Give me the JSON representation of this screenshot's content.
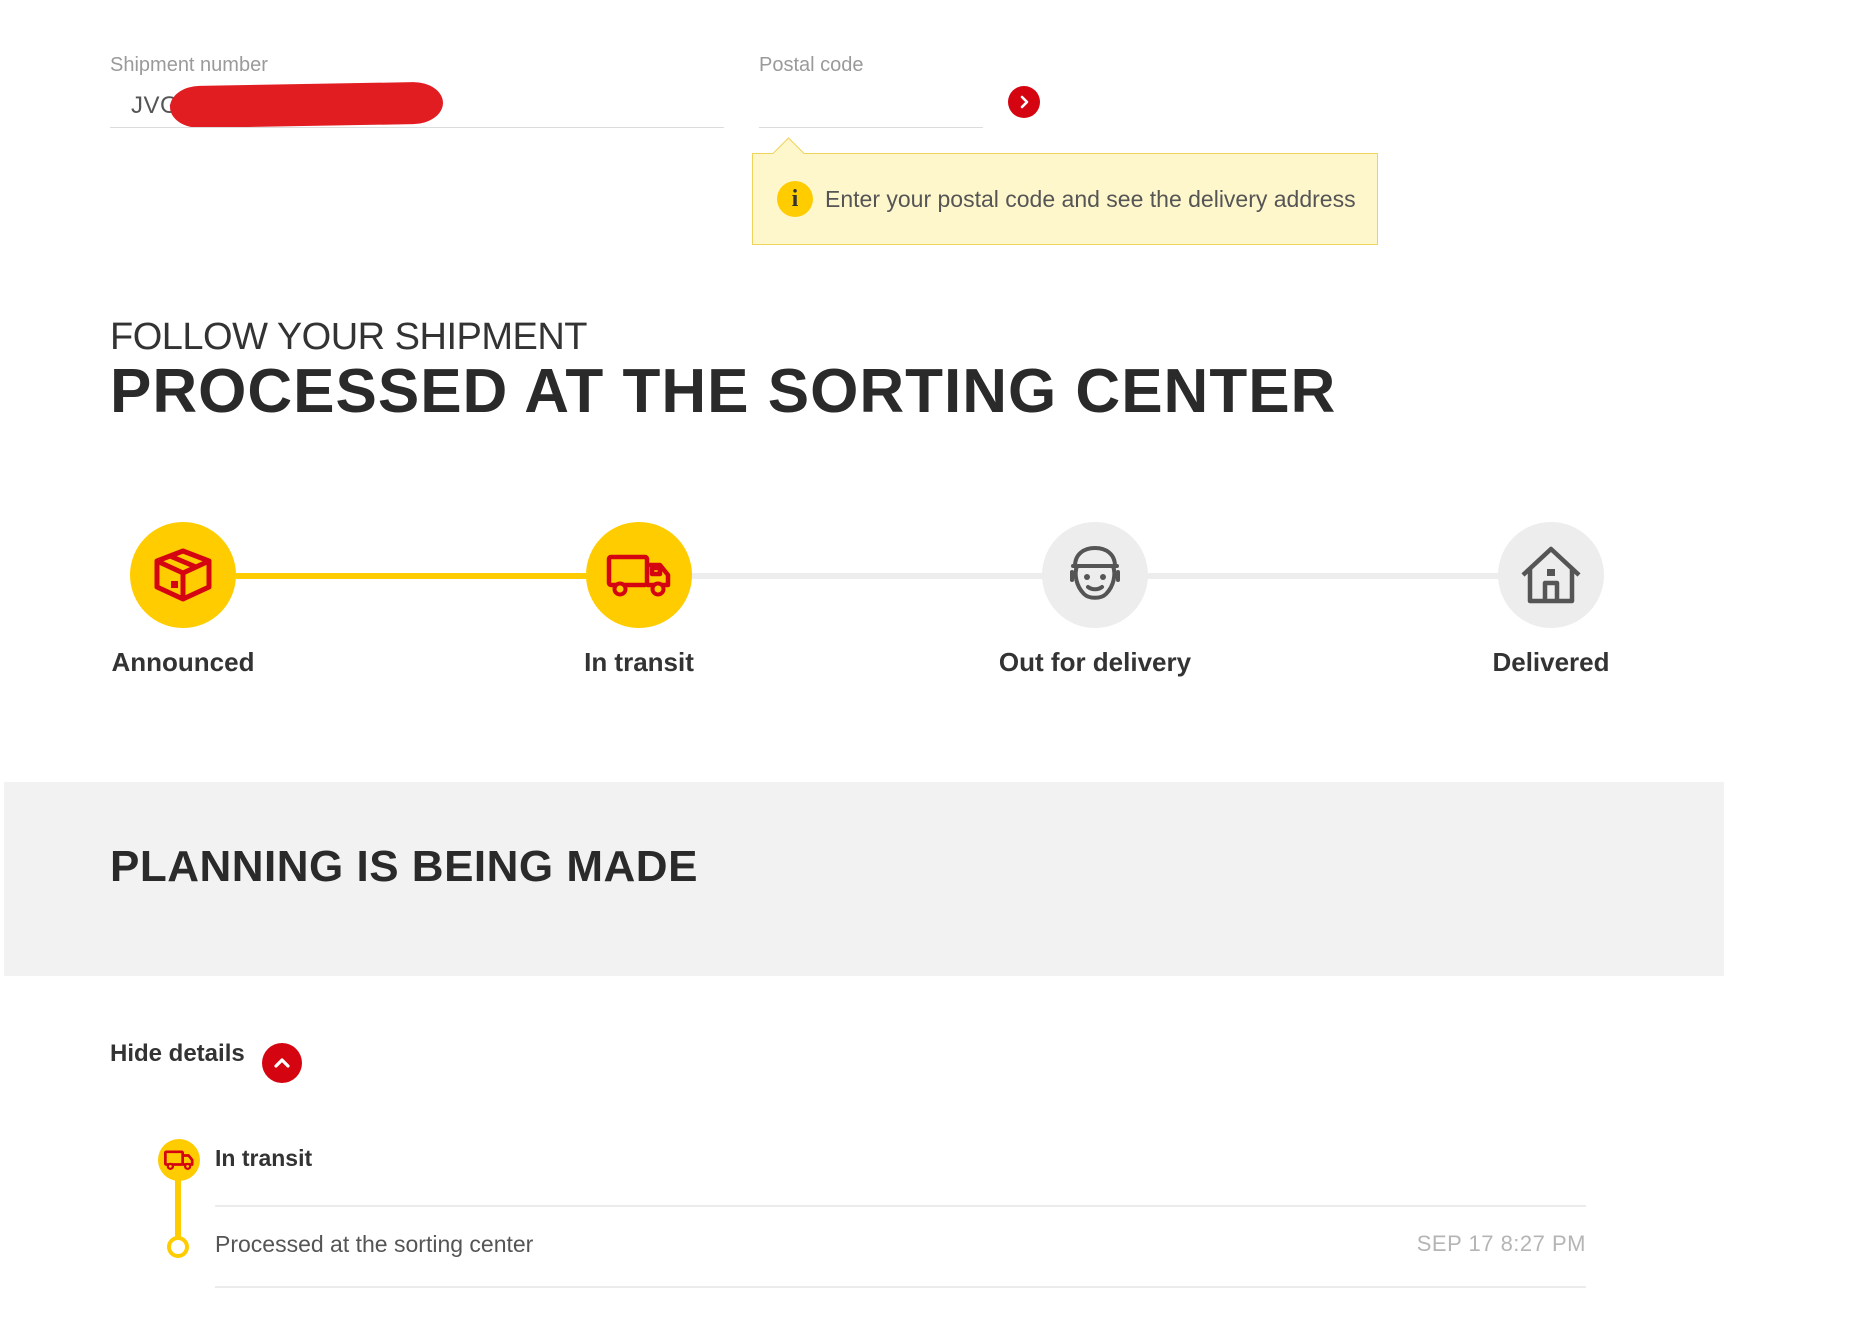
{
  "search": {
    "shipment_label": "Shipment number",
    "shipment_value": "JVG",
    "postal_label": "Postal code",
    "postal_value": "",
    "tip_text": "Enter your postal code and see the delivery address",
    "tip_icon": "i"
  },
  "status": {
    "eyebrow": "FOLLOW YOUR SHIPMENT",
    "headline": "PROCESSED AT THE SORTING CENTER"
  },
  "progress": {
    "steps": [
      {
        "label": "Announced",
        "icon": "package-icon",
        "state": "done"
      },
      {
        "label": "In transit",
        "icon": "truck-icon",
        "state": "current"
      },
      {
        "label": "Out for delivery",
        "icon": "courier-icon",
        "state": "pending"
      },
      {
        "label": "Delivered",
        "icon": "house-icon",
        "state": "pending"
      }
    ]
  },
  "panel": {
    "title": "PLANNING IS BEING MADE"
  },
  "details": {
    "toggle_label": "Hide details",
    "group_title": "In transit",
    "events": [
      {
        "text": "Processed at the sorting center",
        "time": "SEP 17 8:27 PM"
      }
    ]
  },
  "colors": {
    "accent_yellow": "#ffcc00",
    "accent_red": "#d40511",
    "inactive_gray": "#ededed",
    "panel_gray": "#f2f2f2"
  }
}
